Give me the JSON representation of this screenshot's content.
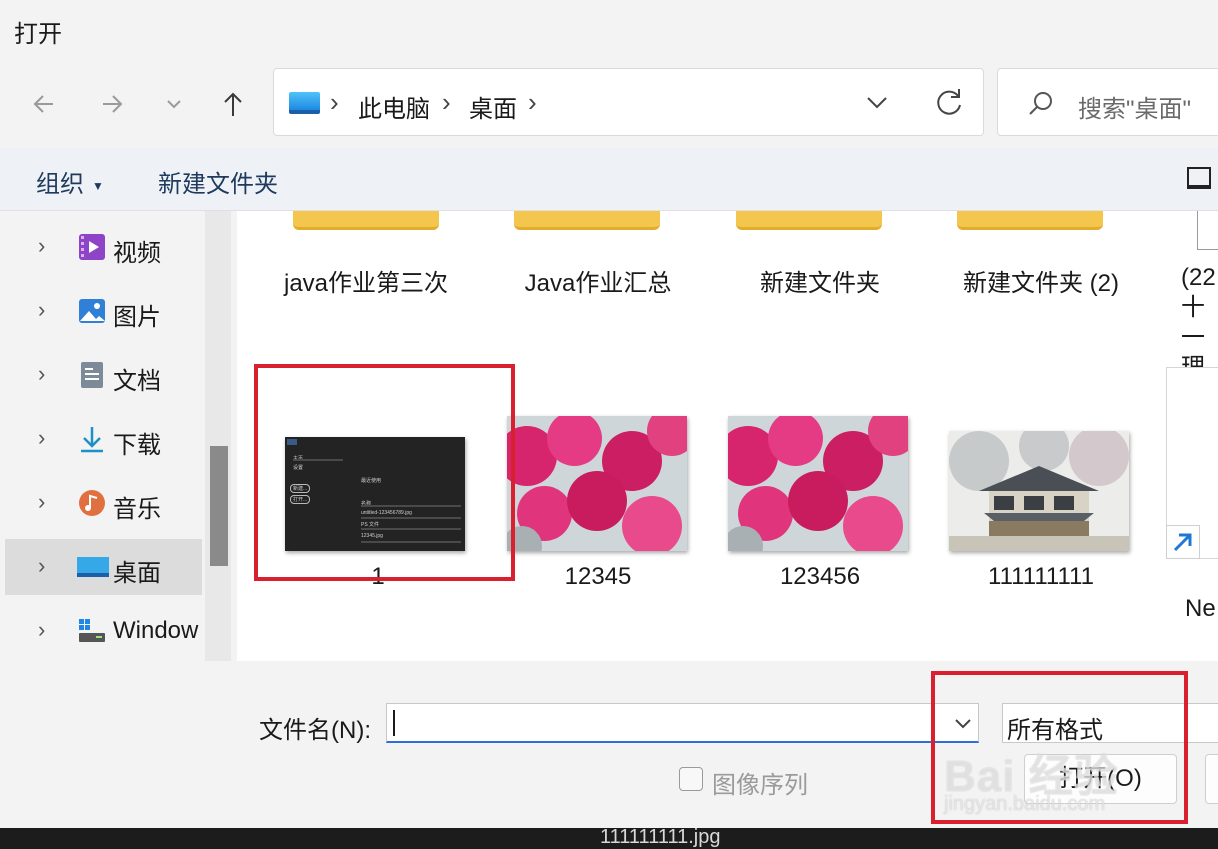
{
  "window": {
    "title": "打开"
  },
  "address": {
    "crumbs": [
      "此电脑",
      "桌面"
    ]
  },
  "search": {
    "placeholder": "搜索\"桌面\""
  },
  "toolbar": {
    "organize": "组织",
    "new_folder": "新建文件夹"
  },
  "sidebar": {
    "items": [
      {
        "label": "视频",
        "icon": "video-icon"
      },
      {
        "label": "图片",
        "icon": "pictures-icon"
      },
      {
        "label": "文档",
        "icon": "documents-icon"
      },
      {
        "label": "下载",
        "icon": "download-icon"
      },
      {
        "label": "音乐",
        "icon": "music-icon"
      },
      {
        "label": "桌面",
        "icon": "desktop-icon",
        "selected": true
      },
      {
        "label": "Window",
        "icon": "drive-icon"
      }
    ]
  },
  "content": {
    "folders": [
      "java作业第三次",
      "Java作业汇总",
      "新建文件夹",
      "新建文件夹 (2)"
    ],
    "partial_item_lines": [
      "(22",
      "十一",
      "理"
    ],
    "files": [
      {
        "name": "1",
        "thumb": "screenshot",
        "thumb_text": [
          "主页",
          "设置",
          "最近使用",
          "新建...",
          "打开...",
          "最近使用项目",
          "名称",
          "untitled-123456789.jpg",
          "PS 文件",
          "12345.jpg"
        ]
      },
      {
        "name": "12345",
        "thumb": "blossom"
      },
      {
        "name": "123456",
        "thumb": "blossom"
      },
      {
        "name": "111111111",
        "thumb": "house"
      }
    ],
    "partial_file": "Ne"
  },
  "footer": {
    "filename_label": "文件名(N):",
    "filename_value": "",
    "filetype": "所有格式",
    "image_sequence_label": "图像序列",
    "image_sequence_checked": false,
    "open_button": "打开(O)"
  },
  "watermark": {
    "brand": "Bai 经验",
    "url": "jingyan.baidu.com"
  },
  "taskbar_filename": "111111111.jpg",
  "colors": {
    "highlight_box": "#d9202e",
    "folder": "#f4c64e",
    "input_focus": "#2a6fdb"
  }
}
